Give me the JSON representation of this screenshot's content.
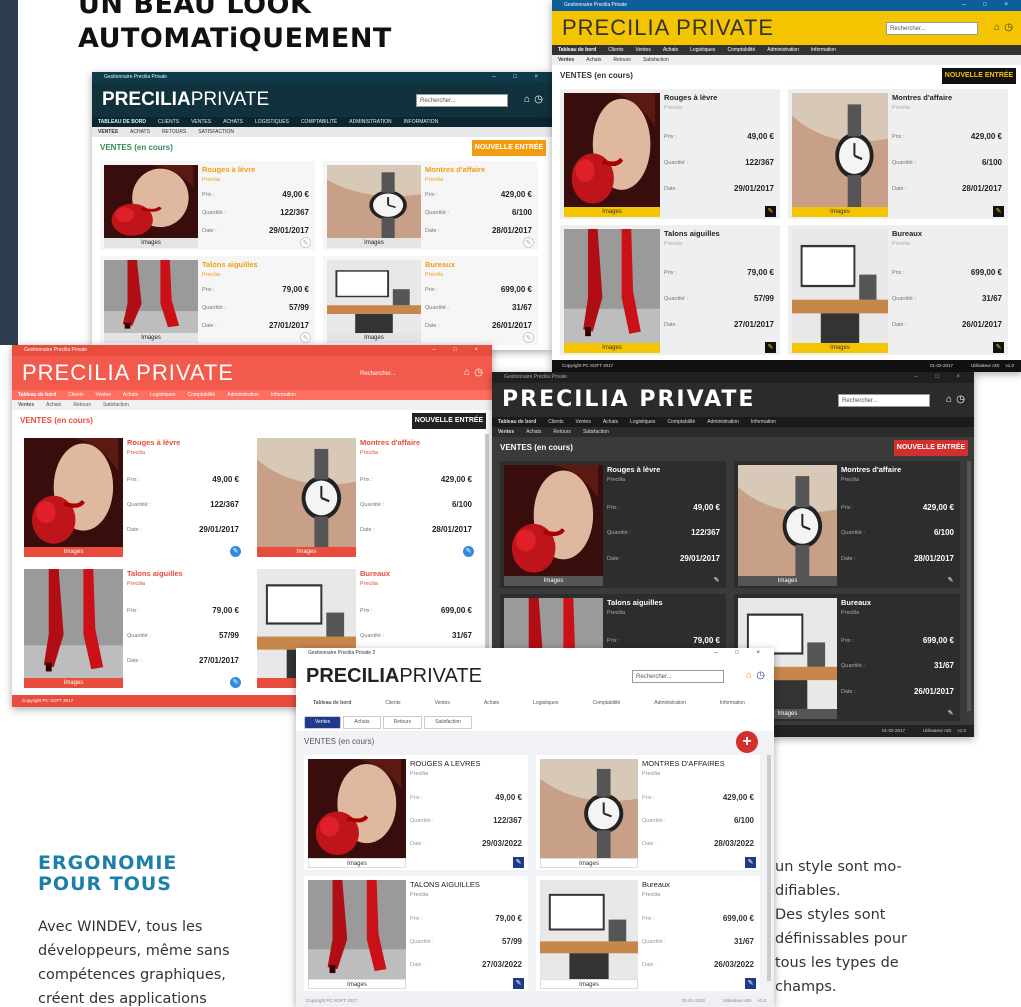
{
  "headline": {
    "line1": "Un beau look",
    "line2": "AUTOMATiQUEMENT"
  },
  "section": {
    "title_line1": "ERGONOMIE",
    "title_line2": "POUR TOUS"
  },
  "text_left": [
    "Avec WINDEV, tous les",
    "développeurs, même sans",
    "compétences graphiques,",
    "créent des applications"
  ],
  "text_right": [
    "un style sont mo-",
    "difiables.",
    "Des styles sont",
    "définissables pour",
    "tous les types de",
    "champs."
  ],
  "app": {
    "window_title": "Gestionnaire Precilia Private",
    "window_title_v2": "Gestionnaire Precilia Private 2",
    "logo_bold": "PRECILIA",
    "logo_light": "PRIVATE",
    "logo_upper": "PRECILIA PRIVATE",
    "search_placeholder": "Rechercher...",
    "section_title": "VENTES (en cours)",
    "section_title_v2": "VENTES (en cours)",
    "new_entry": "NOUVELLE ENTRÉE",
    "images_label": "Images",
    "copyright": "Copyright PC SOFT 2017",
    "copyright_v2": "Copyright PC SOFT 2017",
    "menu": [
      "Tableau de bord",
      "Clients",
      "Ventes",
      "Achats",
      "Logistiques",
      "Comptabilité",
      "Administration",
      "Information"
    ],
    "menu_upper": [
      "TABLEAU DE BORD",
      "CLIENTS",
      "VENTES",
      "ACHATS",
      "LOGISTIQUES",
      "COMPTABILITÉ",
      "ADMINISTRATION",
      "INFORMATION"
    ],
    "tabs": [
      "Ventes",
      "Achats",
      "Retours",
      "Satisfaction"
    ],
    "tabs_upper": [
      "VENTES",
      "ACHATS",
      "RETOURS",
      "SATISFACTION"
    ],
    "fields": {
      "price": "Prix :",
      "qty": "Quantité :",
      "date": "Date :"
    },
    "status_date": "01-02-2017",
    "status_user": "Utilisateur ADI",
    "status_version": "v1.0",
    "status_date_v2": "31-01-2022",
    "products": [
      {
        "name": "Rouges à lèvre",
        "name_upper": "ROUGES A LEVRES",
        "brand": "Precilia",
        "price": "49,00 €",
        "qty": "122/367",
        "date": "29/01/2017",
        "date_v2": "29/03/2022"
      },
      {
        "name": "Montres d'affaire",
        "name_upper": "MONTRES D'AFFAIRES",
        "brand": "Precilia",
        "price": "429,00 €",
        "qty": "6/100",
        "date": "28/01/2017",
        "date_v2": "28/03/2022"
      },
      {
        "name": "Talons aiguilles",
        "name_upper": "TALONS AIGUILLES",
        "brand": "Precilia",
        "price": "79,00 €",
        "qty": "57/99",
        "date": "27/01/2017",
        "date_v2": "27/03/2022"
      },
      {
        "name": "Bureaux",
        "name_upper": "Bureaux",
        "brand": "Precilia",
        "price": "699,00 €",
        "qty": "31/67",
        "date": "26/01/2017",
        "date_v2": "26/03/2022"
      }
    ]
  },
  "colors": {
    "accent_blue": "#1c7fa8",
    "orange": "#f39c12",
    "yellow": "#f5c400",
    "red": "#e74c3c",
    "dark": "#2b2b2b",
    "navy": "#1f3a8a"
  }
}
